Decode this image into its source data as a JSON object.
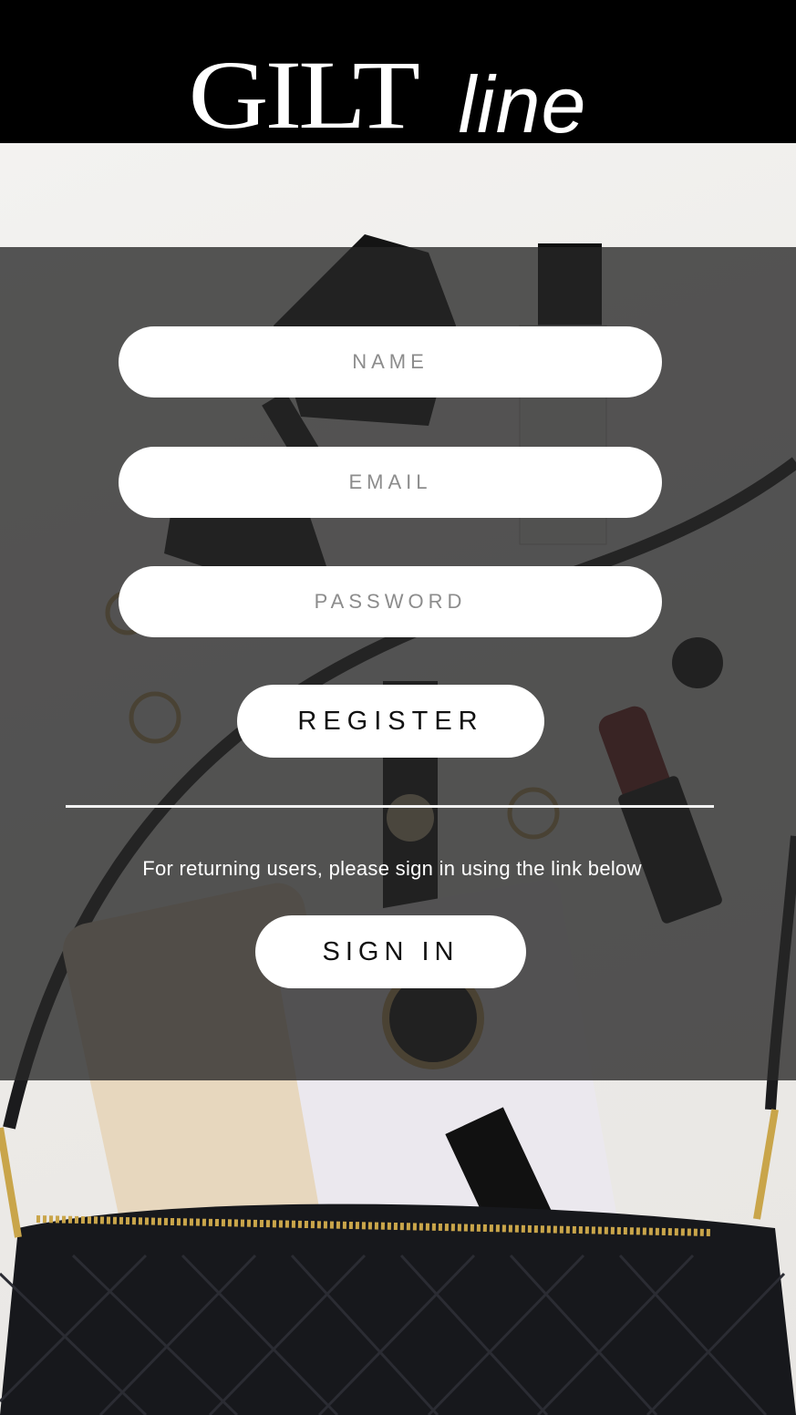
{
  "brand": {
    "logo_main": "GILT",
    "logo_sub": "line"
  },
  "form": {
    "name_placeholder": "NAME",
    "email_placeholder": "EMAIL",
    "password_placeholder": "PASSWORD",
    "register_label": "REGISTER",
    "returning_text": "For returning users, please sign in using the link below",
    "signin_label": "SIGN IN"
  },
  "colors": {
    "header_bg": "#000000",
    "overlay": "rgba(38,38,38,0.78)",
    "button_bg": "#ffffff"
  }
}
